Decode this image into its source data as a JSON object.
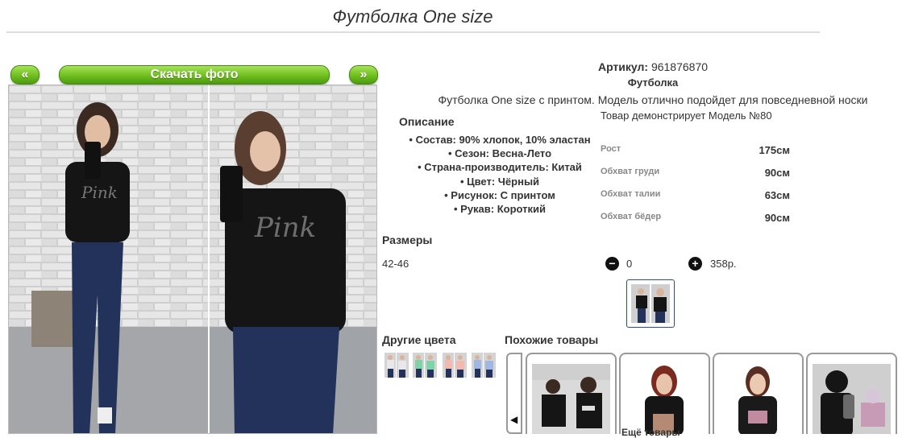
{
  "product": {
    "title": "Футболка One size",
    "article_label": "Артикул:",
    "article_value": "961876870",
    "type": "Футболка",
    "short_desc": "Футболка One size с принтом. Модель отлично подойдет для повседневной носки",
    "print_text": "Pink"
  },
  "gallery": {
    "prev_label": "«",
    "download_label": "Скачать фото",
    "next_label": "»"
  },
  "description": {
    "heading": "Описание",
    "attributes": [
      "• Состав: 90% хлопок, 10% эластан",
      "• Сезон: Весна-Лето",
      "• Страна-производитель: Китай",
      "• Цвет: Чёрный",
      "• Рисунок: С принтом",
      "• Рукав: Короткий"
    ]
  },
  "model": {
    "heading": "Товар демонстрирует Модель №80",
    "measurements": [
      {
        "label": "Рост",
        "value": "175см"
      },
      {
        "label": "Обхват груди",
        "value": "90см"
      },
      {
        "label": "Обхват талии",
        "value": "63см"
      },
      {
        "label": "Обхват бёдер",
        "value": "90см"
      }
    ]
  },
  "sizes": {
    "heading": "Размеры",
    "size": "42-46",
    "quantity": "0",
    "price": "358р."
  },
  "other_colors": {
    "heading": "Другие цвета",
    "shirt_colors": [
      "#e8e8ec",
      "#7fd3a8",
      "#f2b9b2",
      "#9fb8e3"
    ]
  },
  "similar": {
    "heading": "Похожие товары",
    "more_label": "Ещё товары",
    "arrow": "◀"
  },
  "colors": {
    "accent_green": "#6fbe1e",
    "shirt_black": "#151515",
    "jeans_blue": "#22325a"
  }
}
